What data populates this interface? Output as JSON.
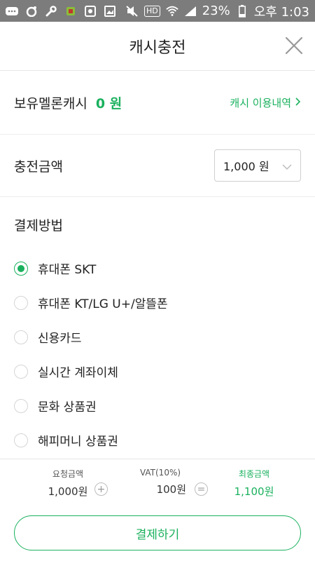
{
  "status_bar": {
    "battery_percent": "23%",
    "time": "오후 1:03",
    "hd_label": "HD",
    "left_icons": [
      "chat-icon",
      "camera-ring-icon",
      "wrench-icon",
      "android-icon",
      "photo-icon",
      "image-icon"
    ],
    "right_icons": [
      "mute-icon",
      "hd-voice-icon",
      "wifi-icon",
      "signal-icon",
      "battery-icon"
    ]
  },
  "header": {
    "title": "캐시충전",
    "close_icon": "close-icon"
  },
  "cash": {
    "label": "보유멜론캐시",
    "value": "0 원",
    "history_link": "캐시 이용내역"
  },
  "charge": {
    "label": "충전금액",
    "selected_amount": "1,000 원"
  },
  "payment": {
    "title": "결제방법",
    "options": [
      {
        "label": "휴대폰 SKT",
        "checked": true
      },
      {
        "label": "휴대폰 KT/LG U+/알뜰폰",
        "checked": false
      },
      {
        "label": "신용카드",
        "checked": false
      },
      {
        "label": "실시간 계좌이체",
        "checked": false
      },
      {
        "label": "문화 상품권",
        "checked": false
      },
      {
        "label": "해피머니 상품권",
        "checked": false
      }
    ]
  },
  "summary": {
    "request": {
      "label": "요청금액",
      "value": "1,000원"
    },
    "vat": {
      "label": "VAT(10%)",
      "value": "100원"
    },
    "final": {
      "label": "최종금액",
      "value": "1,100원"
    },
    "plus": "+",
    "equals": "="
  },
  "pay_button": {
    "label": "결제하기"
  },
  "colors": {
    "accent": "#1ab15e",
    "status_bar": "#7c7c7c"
  }
}
